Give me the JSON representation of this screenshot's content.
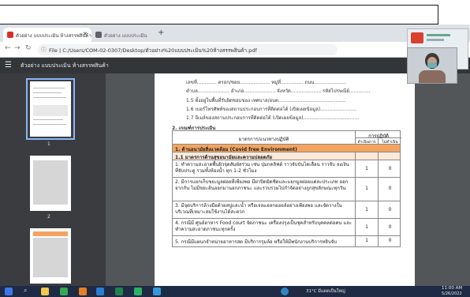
{
  "browser": {
    "tabs": [
      {
        "label": "ตัวอย่าง แบบประเมิน ห้างสรรพสินค้า",
        "active": true
      },
      {
        "label": "ตัวอย่าง แบบประเมิน",
        "active": false
      }
    ],
    "url": "File | C:/Users/COM-02-0307/Desktop/ตัวอย่าง%20แบบประเมิน%20ห้างสรรพสินค้า.pdf"
  },
  "pdf": {
    "title": "ตัวอย่าง แบบประเมิน ห้างสรรพสินค้า",
    "thumbnail_numbers": [
      "1",
      "2"
    ]
  },
  "page": {
    "lines": [
      "เลขที่............. ตรอก/ซอย.................... หมู่ที่............... ถนน.....................",
      "ตำบล..................... อำเภอ..................... จังหวัด.................... รหัสไปรษณีย์..............",
      "1.5 ตั้งอยู่ในพื้นที่รับผิดชอบของ เทศบาล/อบต.............................................",
      "1.6 เบอร์โทรศัพท์ของสถานประกอบการที่ติดต่อได้ (เปิดเผยข้อมูล)........................",
      "1.7 อีเมล์ของสถานประกอบการที่ติดต่อได้ (เปิดเผยข้อมูล)....................................."
    ],
    "section_title": "2. เกณฑ์การประเมิน",
    "table": {
      "header_main": "มาตรการ/แนวทางปฏิบัติ",
      "header_group": "การปฏิบัติ",
      "header_cols": [
        "ดำเนินการ",
        "ไม่ดำเนินการ"
      ],
      "category": "1. ด้านอนามัยสิ่งแวดล้อม (Covid free Environment)",
      "subcategory": "1.1 มาตรการด้านสุขอนามัยและความปลอดภัย",
      "rows": [
        {
          "text": "1. ทำความสะอาดพื้นผิวจุดสัมผัสร่วม เช่น ปุ่มกดลิฟต์ ราวจับบันไดเลื่อน ราวจับ ลงเงิน ที่จับประตู รวมทั้งห้องน้ำ ทุก 1-2 ชั่วโมง",
          "done": "1",
          "not_done": "0"
        },
        {
          "text": "2. มีการแยกเก็บขยะมูลฝอยที่เพียงพอ มีฝาปิดมิดชิดและแยกมูลฝอยแต่ละประเภท ออกจากกัน ไม่มีขยะล้นออกมานอกภาชนะ และรวบรวมไปกำจัดอย่างถูกสุขลักษณะทุกวัน",
          "done": "1",
          "not_done": "0"
        },
        {
          "text": "3. มีจุดบริการล้างมือด้วยสบู่และน้ำ หรือเจลแอลกอฮอล์อย่างเพียงพอ และจัดวางใน บริเวณที่เหมาะสมใช้งานได้สะดวก",
          "done": "1",
          "not_done": "0"
        },
        {
          "text": "4. กรณีมี ศูนย์อาหาร Food court จัดภาชนะ เครื่องปรุงเป็นชุดสำหรับบุคคลต่อคน และทำความสะอาดภาชนะทุกครั้ง",
          "done": "1",
          "not_done": "0"
        },
        {
          "text": "5. กรณีมีแผนกจำหน่ายอาหารสด มีบริการรุมล้อ หรือให้มีพนักงานบริการหยิบจับ",
          "done": "1",
          "not_done": "0"
        }
      ]
    }
  },
  "taskbar": {
    "weather": "31°C มีแดดเป็นใหญ่",
    "time": "11:00 AM",
    "date": "5/26/2022"
  },
  "colors": {
    "category_bg": "#f4a460",
    "subcategory_bg": "#fde9d9",
    "taskbar_bg": "#1f2a44",
    "pdf_toolbar": "#323639",
    "viewer_bg": "#525659"
  }
}
